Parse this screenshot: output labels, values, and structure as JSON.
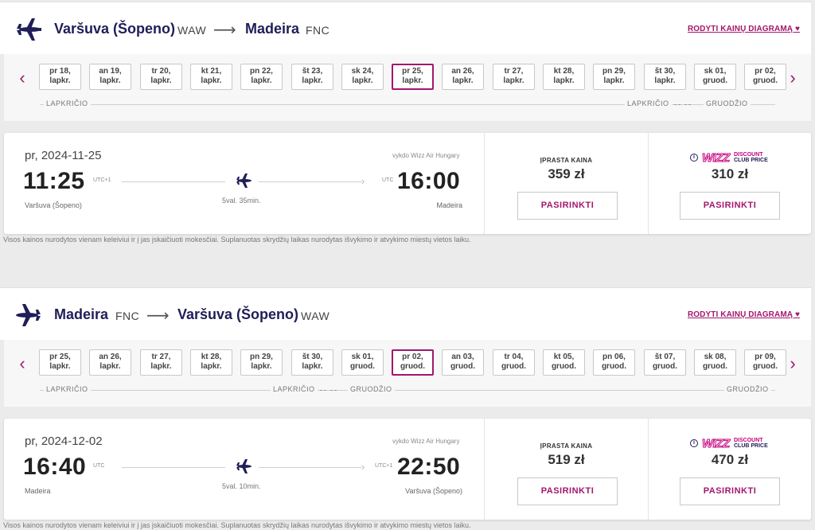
{
  "outbound": {
    "from_city": "Varšuva (Šopeno)",
    "from_code": "WAW",
    "arrow": "⟶",
    "to_city": "Madeira",
    "to_code": "FNC",
    "diagram_link": "RODYTI KAINŲ DIAGRAMĄ ♥",
    "dates": [
      {
        "day": "pr 18,",
        "month": "lapkr."
      },
      {
        "day": "an 19,",
        "month": "lapkr."
      },
      {
        "day": "tr 20,",
        "month": "lapkr."
      },
      {
        "day": "kt 21,",
        "month": "lapkr."
      },
      {
        "day": "pn 22,",
        "month": "lapkr."
      },
      {
        "day": "št 23,",
        "month": "lapkr."
      },
      {
        "day": "sk 24,",
        "month": "lapkr."
      },
      {
        "day": "pr 25,",
        "month": "lapkr."
      },
      {
        "day": "an 26,",
        "month": "lapkr."
      },
      {
        "day": "tr 27,",
        "month": "lapkr."
      },
      {
        "day": "kt 28,",
        "month": "lapkr."
      },
      {
        "day": "pn 29,",
        "month": "lapkr."
      },
      {
        "day": "št 30,",
        "month": "lapkr."
      },
      {
        "day": "sk 01,",
        "month": "gruod."
      },
      {
        "day": "pr 02,",
        "month": "gruod."
      }
    ],
    "selected_index": 7,
    "month_labels": [
      "LAPKRIČIO",
      "LAPKRIČIO",
      "GRUODŽIO"
    ],
    "flight": {
      "date": "pr, 2024-11-25",
      "operator": "vykdo Wizz Air Hungary",
      "dep_time": "11:25",
      "dep_tz": "UTC+1",
      "arr_time": "16:00",
      "arr_tz": "UTC",
      "duration": "5val. 35min.",
      "dep_city": "Varšuva (Šopeno)",
      "arr_city": "Madeira",
      "regular_label": "ĮPRASTA KAINA",
      "regular_price": "359 zł",
      "club_price": "310 zł",
      "select_label": "PASIRINKTI"
    }
  },
  "inbound": {
    "from_city": "Madeira",
    "from_code": "FNC",
    "arrow": "⟶",
    "to_city": "Varšuva (Šopeno)",
    "to_code": "WAW",
    "diagram_link": "RODYTI KAINŲ DIAGRAMĄ ♥",
    "dates": [
      {
        "day": "pr 25,",
        "month": "lapkr."
      },
      {
        "day": "an 26,",
        "month": "lapkr."
      },
      {
        "day": "tr 27,",
        "month": "lapkr."
      },
      {
        "day": "kt 28,",
        "month": "lapkr."
      },
      {
        "day": "pn 29,",
        "month": "lapkr."
      },
      {
        "day": "št 30,",
        "month": "lapkr."
      },
      {
        "day": "sk 01,",
        "month": "gruod."
      },
      {
        "day": "pr 02,",
        "month": "gruod."
      },
      {
        "day": "an 03,",
        "month": "gruod."
      },
      {
        "day": "tr 04,",
        "month": "gruod."
      },
      {
        "day": "kt 05,",
        "month": "gruod."
      },
      {
        "day": "pn 06,",
        "month": "gruod."
      },
      {
        "day": "št 07,",
        "month": "gruod."
      },
      {
        "day": "sk 08,",
        "month": "gruod."
      },
      {
        "day": "pr 09,",
        "month": "gruod."
      }
    ],
    "selected_index": 7,
    "month_labels": [
      "LAPKRIČIO",
      "LAPKRIČIO",
      "GRUODŽIO",
      "GRUODŽIO"
    ],
    "flight": {
      "date": "pr, 2024-12-02",
      "operator": "vykdo Wizz Air Hungary",
      "dep_time": "16:40",
      "dep_tz": "UTC",
      "arr_time": "22:50",
      "arr_tz": "UTC+1",
      "duration": "5val. 10min.",
      "dep_city": "Madeira",
      "arr_city": "Varšuva (Šopeno)",
      "regular_label": "ĮPRASTA KAINA",
      "regular_price": "519 zł",
      "club_price": "470 zł",
      "select_label": "PASIRINKTI"
    }
  },
  "club_badge": {
    "info": "i",
    "wizz": "WIZZ",
    "discount": "DISCOUNT",
    "club_price": "CLUB PRICE"
  },
  "disclaimer": "Visos kainos nurodytos vienam keleiviui ir į jas įskaičiuoti mokesčiai. Suplanuotas skrydžių laikas nurodytas išvykimo ir atvykimo miestų vietos laiku.",
  "nav": {
    "prev": "‹",
    "next": "›"
  },
  "colors": {
    "brand_navy": "#1f1e57",
    "brand_magenta": "#a3166c",
    "wizz_pink": "#c6007e"
  }
}
